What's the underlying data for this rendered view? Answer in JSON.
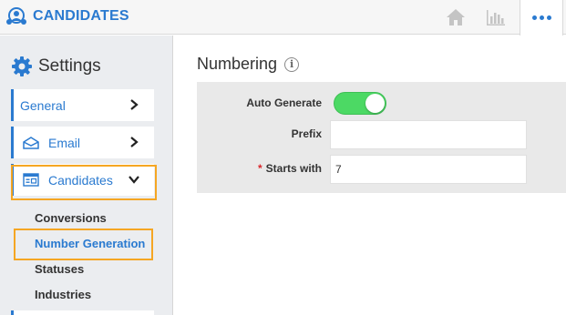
{
  "header": {
    "app_title": "CANDIDATES",
    "icons": [
      "candidates-logo-icon",
      "home-icon",
      "bar-chart-icon",
      "more-dots-icon"
    ],
    "accent_color": "#2a7ad0"
  },
  "sidebar": {
    "heading": "Settings",
    "items": [
      {
        "label": "General",
        "icon": "chevron-right-icon"
      },
      {
        "label": "Email",
        "icon": "envelope-icon"
      },
      {
        "label": "Candidates",
        "icon": "list-window-icon",
        "expanded": true
      }
    ],
    "subitems": [
      "Conversions",
      "Number Generation",
      "Statuses",
      "Industries"
    ],
    "active_subitem": "Number Generation",
    "highlight_color": "#f5a623"
  },
  "main": {
    "title": "Numbering",
    "info_glyph": "i",
    "form": {
      "auto_generate_label": "Auto Generate",
      "auto_generate_on": true,
      "prefix_label": "Prefix",
      "prefix_value": "",
      "starts_with_required": "*",
      "starts_with_label": "Starts with",
      "starts_with_value": "7"
    }
  }
}
